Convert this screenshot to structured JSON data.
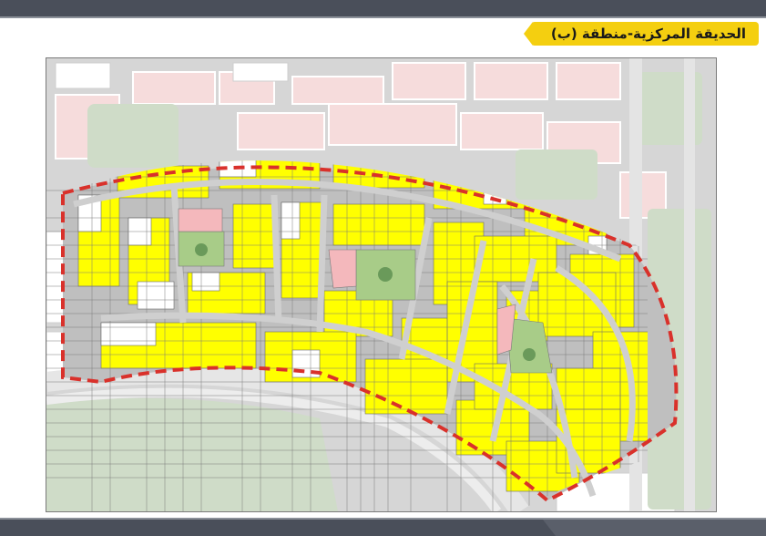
{
  "header": {
    "title": "الحديقة المركزية-منطقة (ب)"
  },
  "colors": {
    "plot": "#ffff00",
    "green": "#a8cc88",
    "pink": "#f4b8bc",
    "road": "#d4d4d4",
    "boundary": "#d9312b",
    "title_bg": "#f4cf10",
    "bar": "#4a4f5a"
  }
}
